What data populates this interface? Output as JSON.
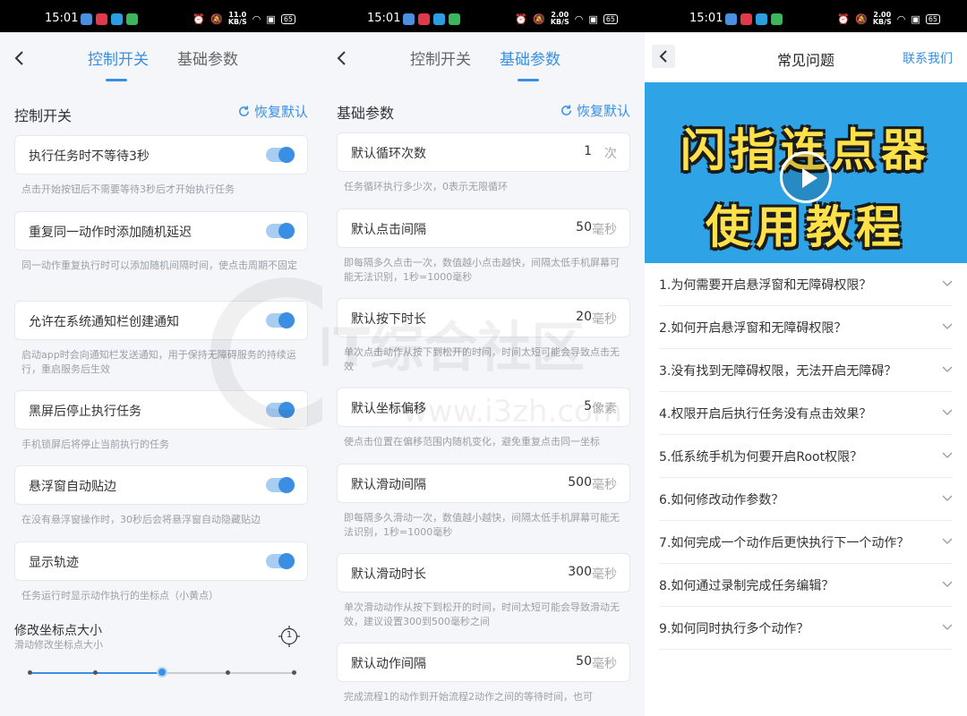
{
  "status": {
    "time": "15:01",
    "panels_speed": [
      "11.0",
      "2.00",
      "2.00"
    ],
    "speed_unit": "KB/S",
    "battery": "65"
  },
  "tabs": {
    "control": "控制开关",
    "basic": "基础参数"
  },
  "panel_a": {
    "section_title": "控制开关",
    "restore_label": "恢复默认",
    "toggles": [
      {
        "label": "执行任务时不等待3秒",
        "desc": "点击开始按钮后不需要等待3秒后才开始执行任务",
        "on": true
      },
      {
        "label": "重复同一动作时添加随机延迟",
        "desc": "同一动作重复执行时可以添加随机间隔时间，使点击周期不固定",
        "on": true
      },
      {
        "label": "允许在系统通知栏创建通知",
        "desc": "启动app时会向通知栏发送通知，用于保持无障碍服务的持续运行，重启服务后生效",
        "on": true
      },
      {
        "label": "黑屏后停止执行任务",
        "desc": "手机锁屏后将停止当前执行的任务",
        "on": true
      },
      {
        "label": "悬浮窗自动贴边",
        "desc": "在没有悬浮窗操作时，30秒后会将悬浮窗自动隐藏贴边",
        "on": true
      },
      {
        "label": "显示轨迹",
        "desc": "任务运行时显示动作执行的坐标点（小黄点）",
        "on": true
      }
    ],
    "marker_size": {
      "title": "修改坐标点大小",
      "subtitle": "滑动修改坐标点大小",
      "icon_value": "1",
      "steps": 5,
      "selected_index": 2
    }
  },
  "panel_b": {
    "section_title": "基础参数",
    "restore_label": "恢复默认",
    "params": [
      {
        "label": "默认循环次数",
        "value": "1",
        "unit": "次",
        "desc": "任务循环执行多少次，0表示无限循环"
      },
      {
        "label": "默认点击间隔",
        "value": "50",
        "unit": "毫秒",
        "desc": "即每隔多久点击一次，数值越小点击越快，间隔太低手机屏幕可能无法识别，1秒=1000毫秒"
      },
      {
        "label": "默认按下时长",
        "value": "20",
        "unit": "毫秒",
        "desc": "单次点击动作从按下到松开的时间，时间太短可能会导致点击无效"
      },
      {
        "label": "默认坐标偏移",
        "value": "5",
        "unit": "像素",
        "desc": "使点击位置在偏移范围内随机变化，避免重复点击同一坐标"
      },
      {
        "label": "默认滑动间隔",
        "value": "500",
        "unit": "毫秒",
        "desc": "即每隔多久滑动一次，数值越小越快，间隔太低手机屏幕可能无法识别，1秒=1000毫秒"
      },
      {
        "label": "默认滑动时长",
        "value": "300",
        "unit": "毫秒",
        "desc": "单次滑动动作从按下到松开的时间，时间太短可能会导致滑动无效，建议设置300到500毫秒之间"
      },
      {
        "label": "默认动作间隔",
        "value": "50",
        "unit": "毫秒",
        "desc": "完成流程1的动作到开始流程2动作之间的等待时间，也可"
      }
    ]
  },
  "panel_c": {
    "title": "常见问题",
    "contact": "联系我们",
    "banner_lines": [
      "闪指连点器",
      "使用教程"
    ],
    "faqs": [
      "1.为何需要开启悬浮窗和无障碍权限？",
      "2.如何开启悬浮窗和无障碍权限？",
      "3.没有找到无障碍权限，无法开启无障碍？",
      "4.权限开启后执行任务没有点击效果？",
      "5.低系统手机为何要开启Root权限？",
      "6.如何修改动作参数？",
      "7.如何完成一个动作后更快执行下一个动作？",
      "8.如何通过录制完成任务编辑？",
      "9.如何同时执行多个动作？"
    ]
  },
  "watermark": {
    "text_cn": "IT综合社区",
    "text_url": "www.i3zh.com"
  },
  "colors": {
    "accent": "#3a8fe2",
    "banner_bg": "#2ea3e6",
    "banner_text": "#ffe14a"
  },
  "icons": [
    "back-arrow-icon",
    "refresh-icon",
    "toggle-switch",
    "chevron-down-icon",
    "play-icon",
    "marker-size-icon"
  ]
}
